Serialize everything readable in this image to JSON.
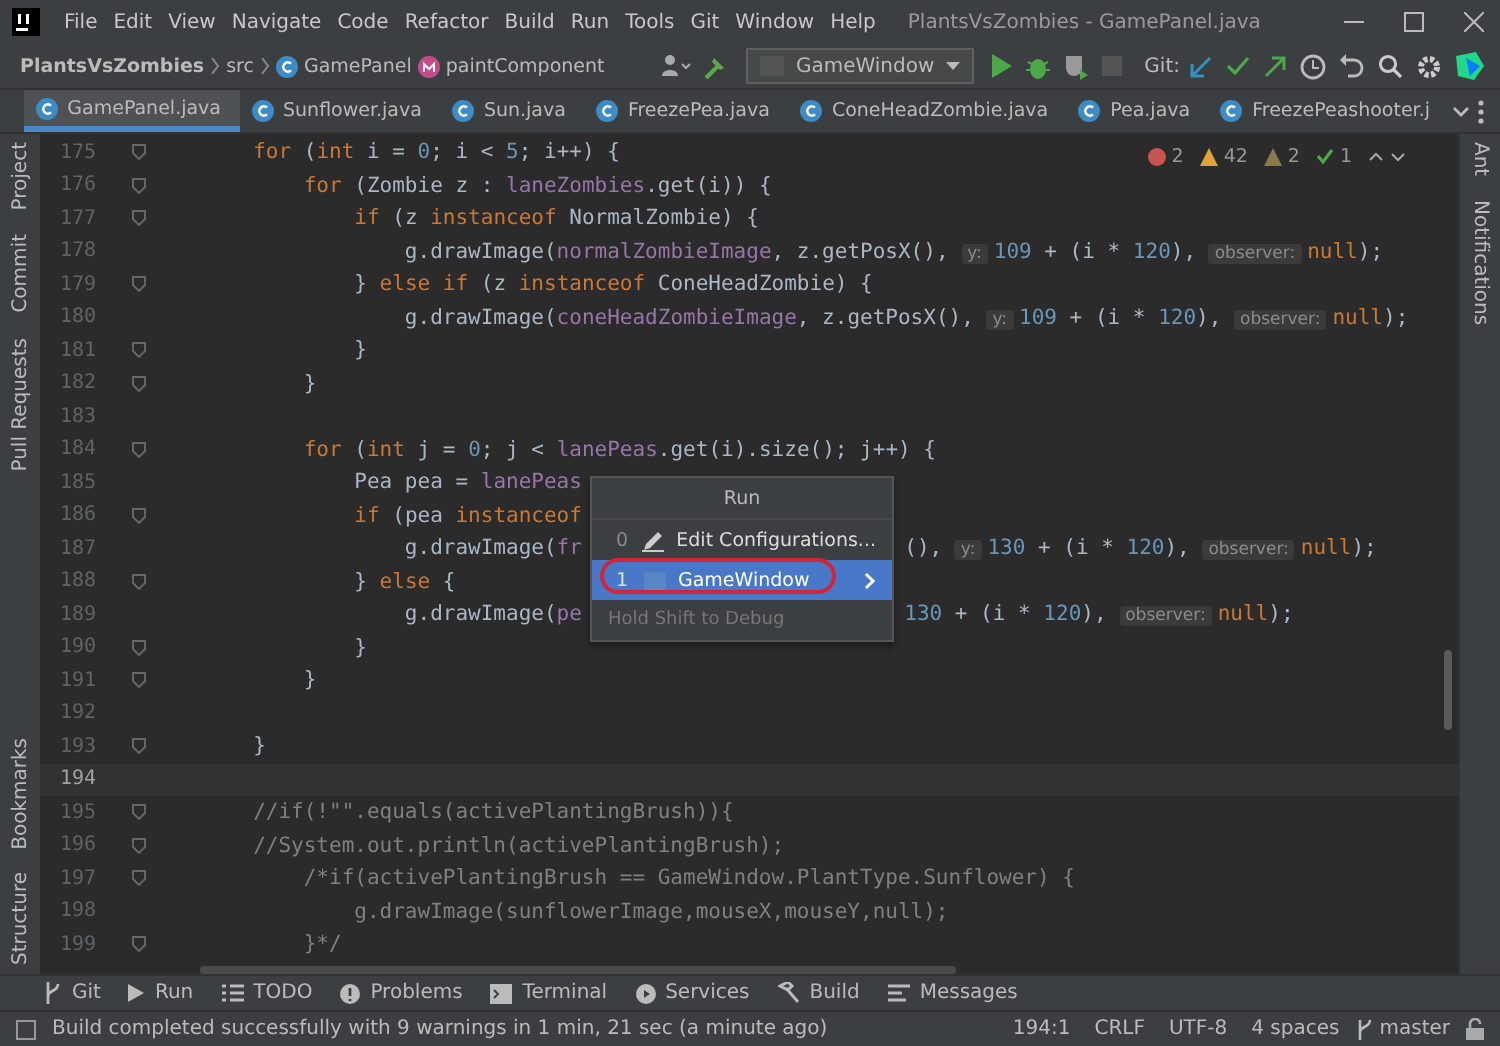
{
  "window": {
    "title": "PlantsVsZombies - GamePanel.java"
  },
  "menu": [
    "File",
    "Edit",
    "View",
    "Navigate",
    "Code",
    "Refactor",
    "Build",
    "Run",
    "Tools",
    "Git",
    "Window",
    "Help"
  ],
  "breadcrumb": {
    "project": "PlantsVsZombies",
    "folder": "src",
    "class_name": "GamePanel",
    "method": "paintComponent"
  },
  "run_config": "GameWindow",
  "git_label": "Git:",
  "tabs": [
    {
      "label": "GamePanel.java",
      "selected": true
    },
    {
      "label": "Sunflower.java",
      "selected": false
    },
    {
      "label": "Sun.java",
      "selected": false
    },
    {
      "label": "FreezePea.java",
      "selected": false
    },
    {
      "label": "ConeHeadZombie.java",
      "selected": false
    },
    {
      "label": "Pea.java",
      "selected": false
    },
    {
      "label": "FreezePeashooter.j",
      "selected": false
    }
  ],
  "left_tools_top": [
    "Project",
    "Commit",
    "Pull Requests"
  ],
  "left_tools_bottom": [
    "Bookmarks",
    "Structure"
  ],
  "right_tools": [
    "Ant",
    "Notifications"
  ],
  "inspections": {
    "errors": "2",
    "warnings": "42",
    "weak_warnings": "2",
    "ok": "1"
  },
  "lines": [
    {
      "number": "175",
      "fold": true,
      "current": false,
      "tokens": [
        {
          "kind": "keyword",
          "text": "        for"
        },
        {
          "kind": "plain",
          "text": " ("
        },
        {
          "kind": "keyword",
          "text": "int"
        },
        {
          "kind": "plain",
          "text": " i = "
        },
        {
          "kind": "number",
          "text": "0"
        },
        {
          "kind": "plain",
          "text": "; i < "
        },
        {
          "kind": "number",
          "text": "5"
        },
        {
          "kind": "plain",
          "text": "; i++) {"
        }
      ]
    },
    {
      "number": "176",
      "fold": true,
      "current": false,
      "tokens": [
        {
          "kind": "keyword",
          "text": "            for"
        },
        {
          "kind": "plain",
          "text": " (Zombie z : "
        },
        {
          "kind": "field",
          "text": "laneZombies"
        },
        {
          "kind": "plain",
          "text": ".get(i)) {"
        }
      ]
    },
    {
      "number": "177",
      "fold": true,
      "current": false,
      "tokens": [
        {
          "kind": "keyword",
          "text": "                if"
        },
        {
          "kind": "plain",
          "text": " (z "
        },
        {
          "kind": "keyword",
          "text": "instanceof"
        },
        {
          "kind": "plain",
          "text": " NormalZombie) {"
        }
      ]
    },
    {
      "number": "178",
      "fold": false,
      "current": false,
      "tokens": [
        {
          "kind": "plain",
          "text": "                    g.drawImage("
        },
        {
          "kind": "field",
          "text": "normalZombieImage"
        },
        {
          "kind": "plain",
          "text": ", z.getPosX(), "
        },
        {
          "kind": "hint",
          "text": "y:"
        },
        {
          "kind": "number",
          "text": "109"
        },
        {
          "kind": "plain",
          "text": " + (i * "
        },
        {
          "kind": "number",
          "text": "120"
        },
        {
          "kind": "plain",
          "text": "), "
        },
        {
          "kind": "hint",
          "text": "observer:"
        },
        {
          "kind": "keyword",
          "text": "null"
        },
        {
          "kind": "plain",
          "text": ");"
        }
      ]
    },
    {
      "number": "179",
      "fold": true,
      "current": false,
      "tokens": [
        {
          "kind": "plain",
          "text": "                } "
        },
        {
          "kind": "keyword",
          "text": "else if"
        },
        {
          "kind": "plain",
          "text": " (z "
        },
        {
          "kind": "keyword",
          "text": "instanceof"
        },
        {
          "kind": "plain",
          "text": " ConeHeadZombie) {"
        }
      ]
    },
    {
      "number": "180",
      "fold": false,
      "current": false,
      "tokens": [
        {
          "kind": "plain",
          "text": "                    g.drawImage("
        },
        {
          "kind": "field",
          "text": "coneHeadZombieImage"
        },
        {
          "kind": "plain",
          "text": ", z.getPosX(), "
        },
        {
          "kind": "hint",
          "text": "y:"
        },
        {
          "kind": "number",
          "text": "109"
        },
        {
          "kind": "plain",
          "text": " + (i * "
        },
        {
          "kind": "number",
          "text": "120"
        },
        {
          "kind": "plain",
          "text": "), "
        },
        {
          "kind": "hint",
          "text": "observer:"
        },
        {
          "kind": "keyword",
          "text": "null"
        },
        {
          "kind": "plain",
          "text": ");"
        }
      ]
    },
    {
      "number": "181",
      "fold": true,
      "current": false,
      "tokens": [
        {
          "kind": "plain",
          "text": "                }"
        }
      ]
    },
    {
      "number": "182",
      "fold": true,
      "current": false,
      "tokens": [
        {
          "kind": "plain",
          "text": "            }"
        }
      ]
    },
    {
      "number": "183",
      "fold": false,
      "current": false
    },
    {
      "number": "184",
      "fold": true,
      "current": false,
      "tokens": [
        {
          "kind": "keyword",
          "text": "            for"
        },
        {
          "kind": "plain",
          "text": " ("
        },
        {
          "kind": "keyword",
          "text": "int"
        },
        {
          "kind": "plain",
          "text": " j = "
        },
        {
          "kind": "number",
          "text": "0"
        },
        {
          "kind": "plain",
          "text": "; j < "
        },
        {
          "kind": "field",
          "text": "lanePeas"
        },
        {
          "kind": "plain",
          "text": ".get(i).size(); j++) {"
        }
      ]
    },
    {
      "number": "185",
      "fold": false,
      "current": false,
      "tokens": [
        {
          "kind": "plain",
          "text": "                Pea pea = "
        },
        {
          "kind": "field",
          "text": "lanePeas"
        }
      ]
    },
    {
      "number": "186",
      "fold": true,
      "current": false,
      "tokens": [
        {
          "kind": "keyword",
          "text": "                if"
        },
        {
          "kind": "plain",
          "text": " (pea "
        },
        {
          "kind": "keyword",
          "text": "instanceof"
        }
      ]
    },
    {
      "number": "187",
      "fold": false,
      "current": false,
      "tokens": [
        {
          "kind": "plain",
          "text": "                    g.drawImage("
        },
        {
          "kind": "field",
          "text": "fr"
        }
      ],
      "after": [
        {
          "kind": "plain",
          "text": "(), "
        },
        {
          "kind": "hint",
          "text": "y:"
        },
        {
          "kind": "number",
          "text": "130"
        },
        {
          "kind": "plain",
          "text": " + (i * "
        },
        {
          "kind": "number",
          "text": "120"
        },
        {
          "kind": "plain",
          "text": "), "
        },
        {
          "kind": "hint",
          "text": "observer:"
        },
        {
          "kind": "keyword",
          "text": "null"
        },
        {
          "kind": "plain",
          "text": ");"
        }
      ]
    },
    {
      "number": "188",
      "fold": true,
      "current": false,
      "tokens": [
        {
          "kind": "plain",
          "text": "                } "
        },
        {
          "kind": "keyword",
          "text": "else"
        },
        {
          "kind": "plain",
          "text": " {"
        }
      ]
    },
    {
      "number": "189",
      "fold": false,
      "current": false,
      "tokens": [
        {
          "kind": "plain",
          "text": "                    g.drawImage("
        },
        {
          "kind": "field",
          "text": "pe"
        }
      ],
      "after": [
        {
          "kind": "number",
          "text": "130"
        },
        {
          "kind": "plain",
          "text": " + (i * "
        },
        {
          "kind": "number",
          "text": "120"
        },
        {
          "kind": "plain",
          "text": "), "
        },
        {
          "kind": "hint",
          "text": "observer:"
        },
        {
          "kind": "keyword",
          "text": "null"
        },
        {
          "kind": "plain",
          "text": ");"
        }
      ]
    },
    {
      "number": "190",
      "fold": true,
      "current": false,
      "tokens": [
        {
          "kind": "plain",
          "text": "                }"
        }
      ]
    },
    {
      "number": "191",
      "fold": true,
      "current": false,
      "tokens": [
        {
          "kind": "plain",
          "text": "            }"
        }
      ]
    },
    {
      "number": "192",
      "fold": false,
      "current": false
    },
    {
      "number": "193",
      "fold": true,
      "current": false,
      "tokens": [
        {
          "kind": "plain",
          "text": "        }"
        }
      ]
    },
    {
      "number": "194",
      "fold": false,
      "current": true
    },
    {
      "number": "195",
      "fold": true,
      "current": false,
      "tokens": [
        {
          "kind": "comment",
          "text": "        //if(!\"\".equals(activePlantingBrush)){"
        }
      ]
    },
    {
      "number": "196",
      "fold": true,
      "current": false,
      "tokens": [
        {
          "kind": "comment",
          "text": "        //System.out.println(activePlantingBrush);"
        }
      ]
    },
    {
      "number": "197",
      "fold": true,
      "current": false,
      "tokens": [
        {
          "kind": "comment",
          "text": "            /*if(activePlantingBrush == GameWindow.PlantType.Sunflower) {"
        }
      ]
    },
    {
      "number": "198",
      "fold": false,
      "current": false,
      "tokens": [
        {
          "kind": "comment",
          "text": "                g.drawImage(sunflowerImage,mouseX,mouseY,null);"
        }
      ]
    },
    {
      "number": "199",
      "fold": true,
      "current": false,
      "tokens": [
        {
          "kind": "comment",
          "text": "            }*/"
        }
      ]
    }
  ],
  "run_popup": {
    "title": "Run",
    "items": [
      {
        "key": "0",
        "label": "Edit Configurations...",
        "kind": "edit",
        "selected": false
      },
      {
        "key": "1",
        "label": "GameWindow",
        "kind": "config",
        "selected": true
      }
    ],
    "footer": "Hold Shift to Debug"
  },
  "tool_windows": [
    "Git",
    "Run",
    "TODO",
    "Problems",
    "Terminal",
    "Services",
    "Build",
    "Messages"
  ],
  "status": {
    "message": "Build completed successfully with 9 warnings in 1 min, 21 sec (a minute ago)",
    "position": "194:1",
    "line_separator": "CRLF",
    "encoding": "UTF-8",
    "indent": "4 spaces",
    "branch": "master"
  }
}
